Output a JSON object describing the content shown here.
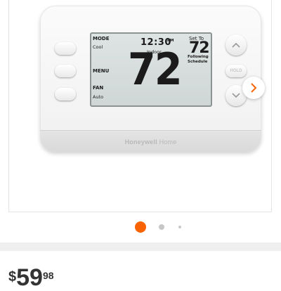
{
  "thermostat": {
    "brand_bold": "Honeywell",
    "brand_light": "Home",
    "hold_label": "HOLD",
    "display": {
      "mode_label": "MODE",
      "mode_value": "Cool",
      "menu_label": "MENU",
      "fan_label": "FAN",
      "fan_value": "Auto",
      "time": "12:30",
      "ampm": "PM",
      "indoor_label": "Indoor",
      "indoor_temp": "72",
      "set_to_label": "Set To",
      "set_temp": "72",
      "following_label": "Following",
      "schedule_label": "Schedule"
    }
  },
  "carousel": {
    "next_icon": "chevron-right-icon",
    "active_color": "#f96302",
    "dots": 3,
    "active_index": 0
  },
  "price": {
    "currency": "$",
    "dollars": "59",
    "cents": "98"
  },
  "colors": {
    "accent": "#f96302",
    "lcd_background": "#d6dedd"
  }
}
